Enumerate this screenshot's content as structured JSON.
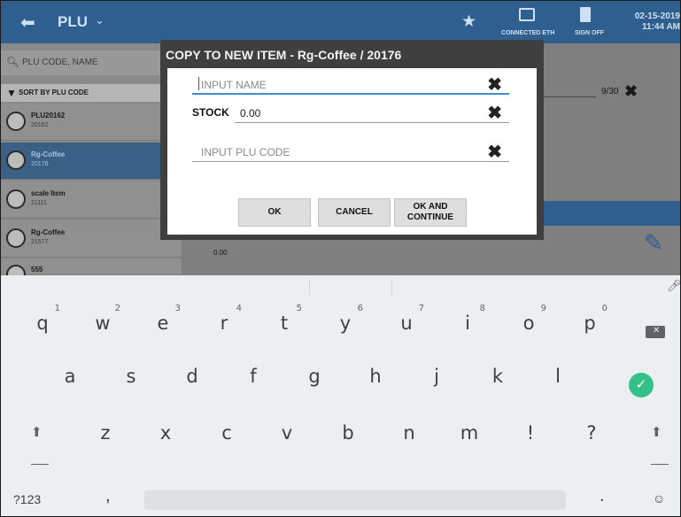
{
  "app_bar": {
    "back_icon": "back-arrow-icon",
    "title": "PLU",
    "title_caret": "chevron-down-icon",
    "connected_label": "CONNECTED ETH",
    "signoff_label": "SIGN OFF",
    "date": "02-15-2019",
    "time": "11:44 AM"
  },
  "background": {
    "search_placeholder": "PLU CODE, NAME",
    "sort_label": "SORT BY PLU CODE",
    "items": [
      {
        "name": "PLU20162",
        "code": "20162"
      },
      {
        "name": "Rg-Coffee",
        "code": "20176"
      },
      {
        "name": "scale Item",
        "code": "21111"
      },
      {
        "name": "Rg-Coffee",
        "code": "21577"
      },
      {
        "name": "555",
        "code": ""
      }
    ],
    "counter": "9/30",
    "value": "0.00"
  },
  "dialog": {
    "title": "COPY TO NEW ITEM - Rg-Coffee / 20176",
    "name_placeholder": "INPUT NAME",
    "stock_label": "STOCK",
    "stock_value": "0.00",
    "plu_placeholder": "INPUT PLU CODE",
    "ok_label": "OK",
    "cancel_label": "CANCEL",
    "ok_continue_line1": "OK AND",
    "ok_continue_line2": "CONTINUE"
  },
  "keyboard": {
    "row1": [
      {
        "key": "q",
        "hint": "1"
      },
      {
        "key": "w",
        "hint": "2"
      },
      {
        "key": "e",
        "hint": "3"
      },
      {
        "key": "r",
        "hint": "4"
      },
      {
        "key": "t",
        "hint": "5"
      },
      {
        "key": "y",
        "hint": "6"
      },
      {
        "key": "u",
        "hint": "7"
      },
      {
        "key": "i",
        "hint": "8"
      },
      {
        "key": "o",
        "hint": "9"
      },
      {
        "key": "p",
        "hint": "0"
      }
    ],
    "row2": [
      "a",
      "s",
      "d",
      "f",
      "g",
      "h",
      "j",
      "k",
      "l"
    ],
    "row3": [
      "z",
      "x",
      "c",
      "v",
      "b",
      "n",
      "m",
      "!",
      "?"
    ],
    "symbols_label": "?123",
    "comma": ",",
    "period": "."
  }
}
